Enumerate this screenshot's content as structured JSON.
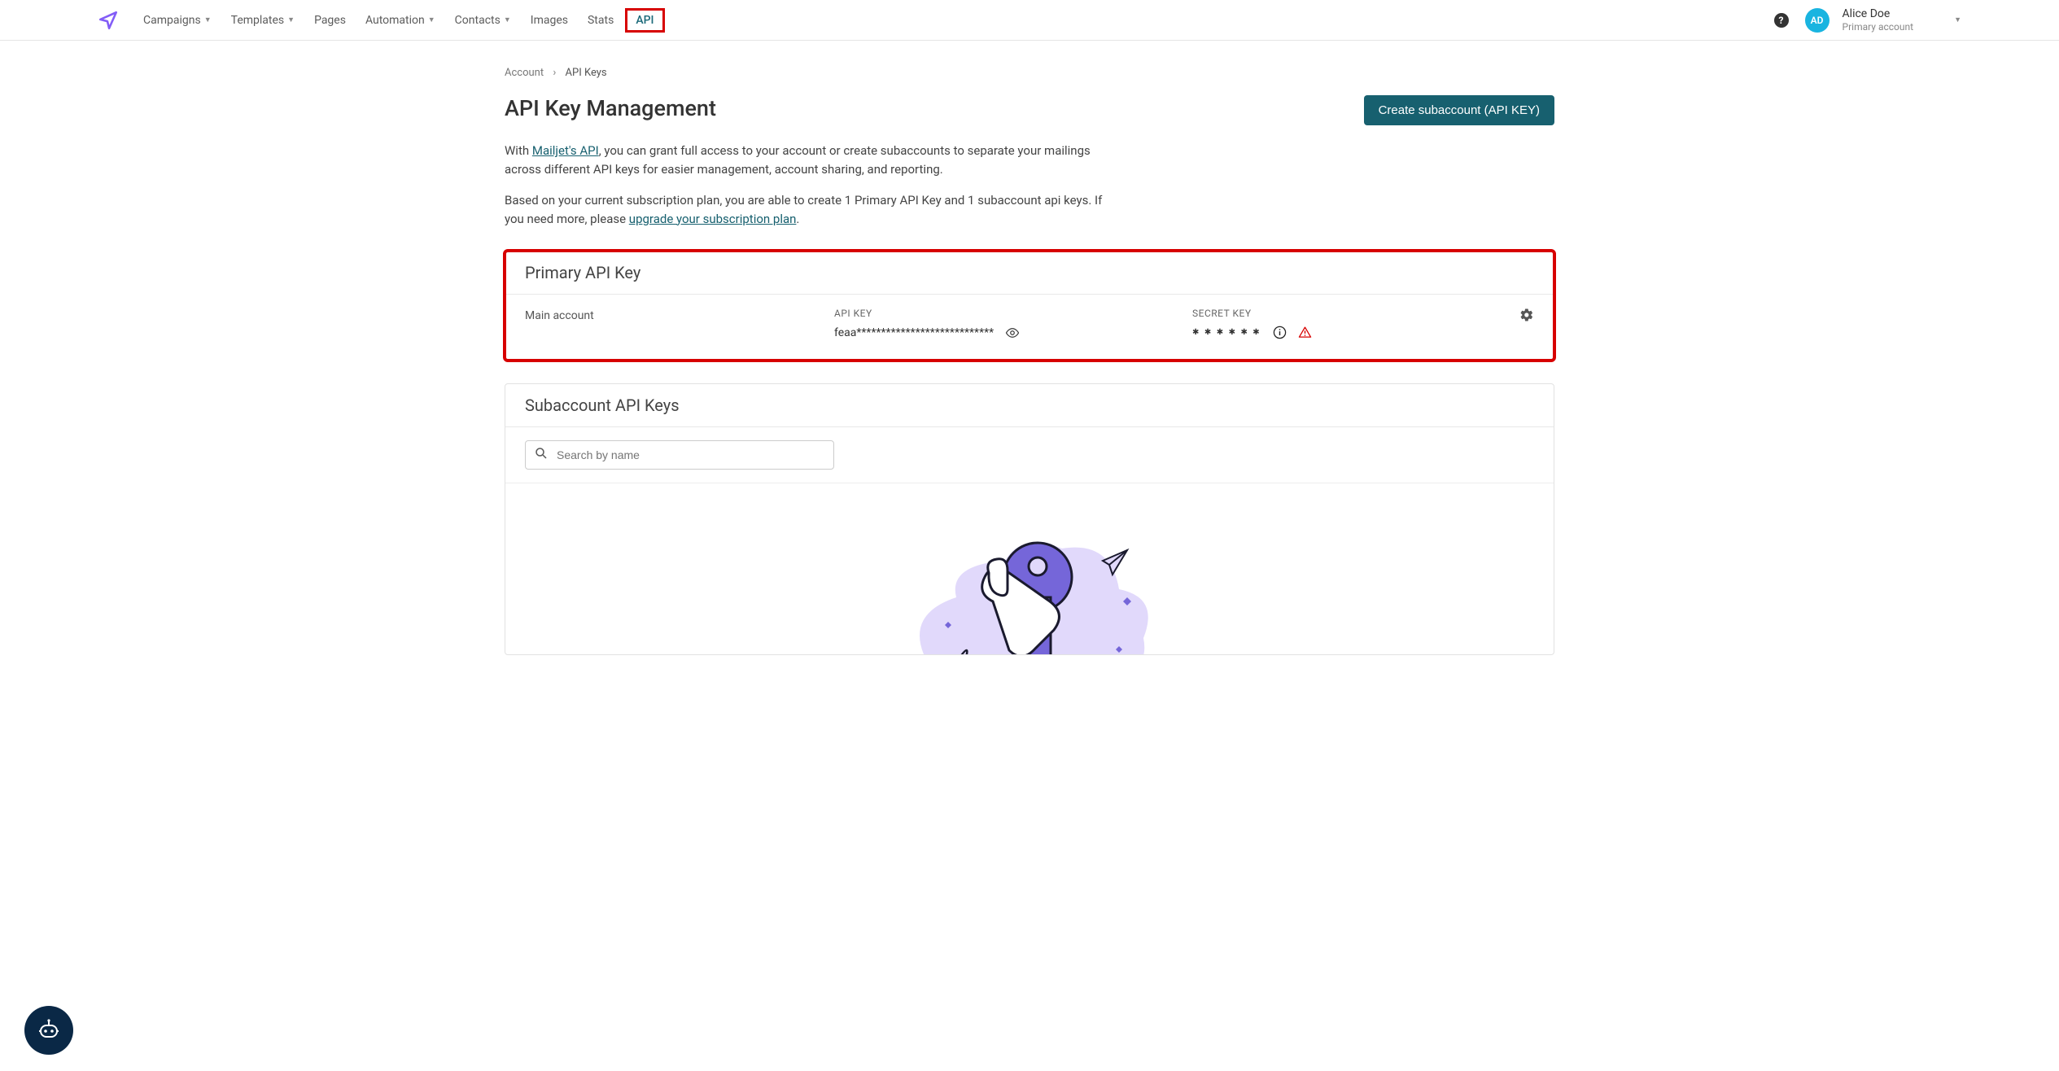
{
  "nav": {
    "items": [
      {
        "label": "Campaigns",
        "dropdown": true
      },
      {
        "label": "Templates",
        "dropdown": true
      },
      {
        "label": "Pages",
        "dropdown": false
      },
      {
        "label": "Automation",
        "dropdown": true
      },
      {
        "label": "Contacts",
        "dropdown": true
      },
      {
        "label": "Images",
        "dropdown": false
      },
      {
        "label": "Stats",
        "dropdown": false
      },
      {
        "label": "API",
        "dropdown": false,
        "active": true
      }
    ]
  },
  "user": {
    "initials": "AD",
    "name": "Alice Doe",
    "subtitle": "Primary account"
  },
  "breadcrumb": {
    "root": "Account",
    "current": "API Keys"
  },
  "page": {
    "title": "API Key Management",
    "cta": "Create subaccount (API KEY)",
    "intro1_pre": "With ",
    "intro1_link": "Mailjet's API",
    "intro1_post": ", you can grant full access to your account or create subaccounts to separate your mailings across different API keys for easier management, account sharing, and reporting.",
    "intro2_pre": "Based on your current subscription plan, you are able to create 1 Primary API Key and 1 subaccount api keys. If you need more, please ",
    "intro2_link": "upgrade your subscription plan",
    "intro2_post": "."
  },
  "primary": {
    "header": "Primary API Key",
    "account_name": "Main account",
    "apikey_label": "API KEY",
    "apikey_value": "feaa****************************",
    "secret_label": "SECRET KEY",
    "secret_value": "✱ ✱ ✱ ✱ ✱ ✱"
  },
  "sub": {
    "header": "Subaccount API Keys",
    "search_placeholder": "Search by name"
  }
}
